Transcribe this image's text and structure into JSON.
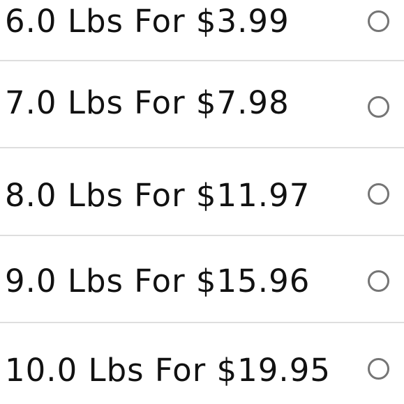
{
  "options": [
    {
      "label": "6.0 Lbs For $3.99",
      "selected": false
    },
    {
      "label": "7.0 Lbs For $7.98",
      "selected": false
    },
    {
      "label": "8.0 Lbs For $11.97",
      "selected": false
    },
    {
      "label": "9.0 Lbs For $15.96",
      "selected": false
    },
    {
      "label": "10.0 Lbs For $19.95",
      "selected": false
    }
  ],
  "colors": {
    "text": "#111111",
    "radio_border": "#757575",
    "divider": "#dedede",
    "background": "#ffffff"
  }
}
